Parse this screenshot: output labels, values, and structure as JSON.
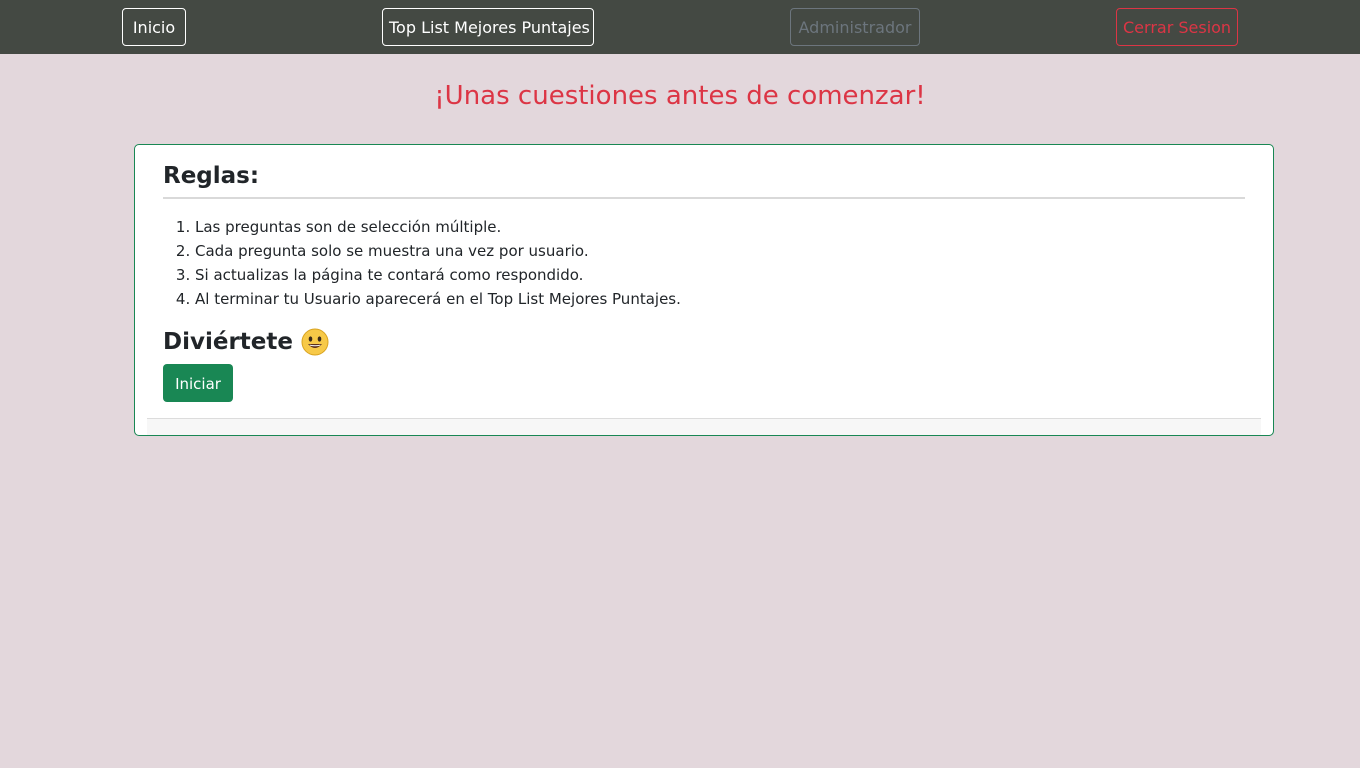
{
  "nav": {
    "inicio_label": "Inicio",
    "toplist_label": "Top List Mejores Puntajes",
    "admin_label": "Administrador",
    "logout_label": "Cerrar Sesion"
  },
  "heading": "¡Unas cuestiones antes de comenzar!",
  "card": {
    "rules_title": "Reglas:",
    "rules": [
      "Las preguntas son de selección múltiple.",
      "Cada pregunta solo se muestra una vez por usuario.",
      "Si actualizas la página te contará como respondido.",
      "Al terminar tu Usuario aparecerá en el Top List Mejores Puntajes."
    ],
    "fun_title": "Diviértete",
    "fun_icon": "smile-icon",
    "start_label": "Iniciar"
  },
  "colors": {
    "navbar": "#444943",
    "background": "#e3d7dc",
    "heading": "#dc3545",
    "success": "#198754",
    "muted": "#6c757d",
    "danger": "#dc3545"
  }
}
